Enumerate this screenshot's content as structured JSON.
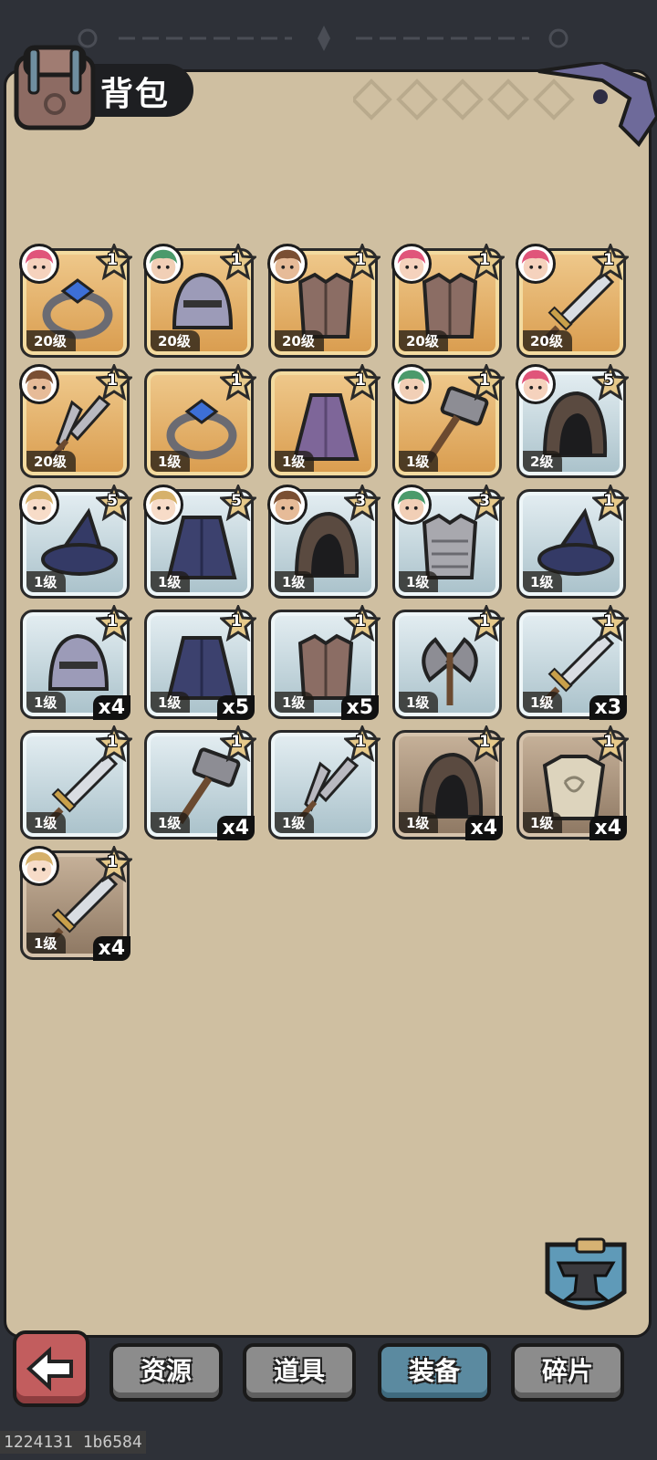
{
  "header": {
    "title": "背包"
  },
  "items": [
    {
      "rarity": "gold",
      "level": "20级",
      "star": "1",
      "art": "ring-icon",
      "portrait": "pink"
    },
    {
      "rarity": "gold",
      "level": "20级",
      "star": "1",
      "art": "helmet-icon",
      "portrait": "green"
    },
    {
      "rarity": "gold",
      "level": "20级",
      "star": "1",
      "art": "armor-icon",
      "portrait": "brown"
    },
    {
      "rarity": "gold",
      "level": "20级",
      "star": "1",
      "art": "armor-icon",
      "portrait": "pink"
    },
    {
      "rarity": "gold",
      "level": "20级",
      "star": "1",
      "art": "sword-icon",
      "portrait": "pink"
    },
    {
      "rarity": "gold",
      "level": "20级",
      "star": "1",
      "art": "dagger-icon",
      "portrait": "brown"
    },
    {
      "rarity": "gold",
      "level": "1级",
      "star": "1",
      "art": "ring-icon"
    },
    {
      "rarity": "gold",
      "level": "1级",
      "star": "1",
      "art": "cloak-icon"
    },
    {
      "rarity": "gold",
      "level": "1级",
      "star": "1",
      "art": "hammer-icon",
      "portrait": "green"
    },
    {
      "rarity": "blue",
      "level": "2级",
      "star": "5",
      "art": "hood-icon",
      "portrait": "pink"
    },
    {
      "rarity": "blue",
      "level": "1级",
      "star": "5",
      "art": "wizard-hat-icon",
      "portrait": "blonde"
    },
    {
      "rarity": "blue",
      "level": "1级",
      "star": "5",
      "art": "robe-icon",
      "portrait": "blonde"
    },
    {
      "rarity": "blue",
      "level": "1级",
      "star": "3",
      "art": "hood-icon",
      "portrait": "brown"
    },
    {
      "rarity": "blue",
      "level": "1级",
      "star": "3",
      "art": "chainmail-icon",
      "portrait": "green"
    },
    {
      "rarity": "blue",
      "level": "1级",
      "star": "1",
      "art": "wizard-hat-icon"
    },
    {
      "rarity": "blue",
      "level": "1级",
      "star": "1",
      "art": "helmet-icon",
      "count": "x4"
    },
    {
      "rarity": "blue",
      "level": "1级",
      "star": "1",
      "art": "robe-icon",
      "count": "x5"
    },
    {
      "rarity": "blue",
      "level": "1级",
      "star": "1",
      "art": "armor-icon",
      "count": "x5"
    },
    {
      "rarity": "blue",
      "level": "1级",
      "star": "1",
      "art": "axe-icon"
    },
    {
      "rarity": "blue",
      "level": "1级",
      "star": "1",
      "art": "sword-icon",
      "count": "x3"
    },
    {
      "rarity": "blue",
      "level": "1级",
      "star": "1",
      "art": "sword-icon"
    },
    {
      "rarity": "blue",
      "level": "1级",
      "star": "1",
      "art": "hammer-icon",
      "count": "x4"
    },
    {
      "rarity": "blue",
      "level": "1级",
      "star": "1",
      "art": "dagger-icon"
    },
    {
      "rarity": "brown",
      "level": "1级",
      "star": "1",
      "art": "hood-icon",
      "count": "x4"
    },
    {
      "rarity": "brown",
      "level": "1级",
      "star": "1",
      "art": "tunic-icon",
      "count": "x4"
    },
    {
      "rarity": "brown",
      "level": "1级",
      "star": "1",
      "art": "sword-icon",
      "count": "x4",
      "portrait": "blonde"
    }
  ],
  "tabs": [
    {
      "label": "资源"
    },
    {
      "label": "道具"
    },
    {
      "label": "装备",
      "active": true
    },
    {
      "label": "碎片"
    }
  ],
  "footer": {
    "debug": "1224131 1b6584"
  },
  "colors": {
    "panel": "#cfbfa1",
    "gold_card": "#e2b06c",
    "blue_card": "#c3d5dc",
    "brown_card": "#a8917a",
    "tab_active": "#5b8aa0",
    "back_button": "#c25d5e"
  }
}
